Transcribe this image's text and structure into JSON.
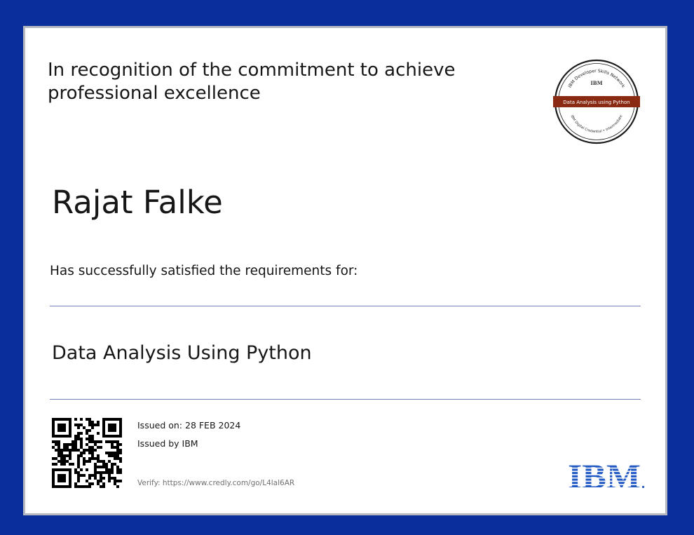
{
  "certificate": {
    "intro": "In recognition of the commitment to achieve professional excellence",
    "recipient_name": "Rajat Falke",
    "requirements_text": "Has successfully satisfied the requirements for:",
    "course_title": "Data Analysis Using Python",
    "issued_on": "Issued on: 28 FEB 2024",
    "issued_by": "Issued by IBM",
    "verify": "Verify: https://www.credly.com/go/L4lal6AR"
  },
  "badge": {
    "arc_top": "IBM Developer Skills Network",
    "brand": "IBM",
    "ribbon": "Data Analysis using Python",
    "arc_bottom": "IBM Digital Credential • Intermediate",
    "ribbon_color": "#8a2a12"
  },
  "logo": {
    "text": "IBM",
    "color": "#1f57c3"
  },
  "colors": {
    "border": "#0a2f9c",
    "rule": "#7283b8"
  },
  "icons": {
    "qr": "qr-code-icon",
    "badge": "credential-badge-icon",
    "logo": "ibm-logo-icon"
  }
}
